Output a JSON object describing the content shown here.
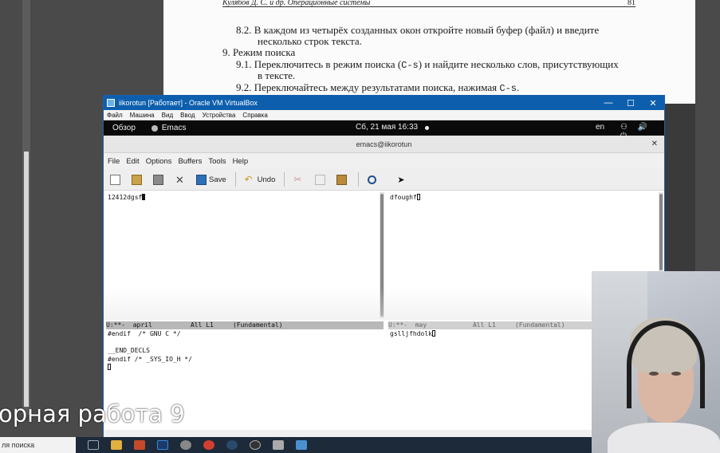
{
  "pdf": {
    "header_authors": "Кулябов Д. С. и др.",
    "header_title": "Операционные системы",
    "page_number": "81",
    "line1": "8.2.  В каждом из четырёх созданных окон откройте новый буфер (файл) и введите",
    "line2": "несколько строк текста.",
    "line3": "9.  Режим поиска",
    "line4a": "9.1.  Переключитесь в режим поиска (",
    "line4code": "C-s",
    "line4b": ") и найдите несколько слов, присутствующих",
    "line5": "в тексте.",
    "line6a": "9.2.  Переключайтесь между результатами поиска, нажимая ",
    "line6code": "C-s",
    "line6b": "."
  },
  "vbox": {
    "title": "iikorotun [Работает] - Oracle VM VirtualBox",
    "menu": [
      "Файл",
      "Машина",
      "Вид",
      "Ввод",
      "Устройства",
      "Справка"
    ],
    "controls": [
      "—",
      "☐",
      "✕"
    ]
  },
  "gnome": {
    "activities": "Обзор",
    "app": "Emacs",
    "clock": "Сб, 21 мая 16:33",
    "lang": "en",
    "sys_icons": "⚇ 🔊 ⏻"
  },
  "emacs": {
    "title": "emacs@iikorotun",
    "close": "✕",
    "menu": [
      "File",
      "Edit",
      "Options",
      "Buffers",
      "Tools",
      "Help"
    ],
    "toolbar": {
      "save": "Save",
      "undo": "Undo"
    },
    "windows": {
      "top_left_text": "12412dgsf",
      "top_right_text": "dfoughf",
      "bottom_left_lines": [
        "#endif  /* GNU C */",
        "",
        "__END_DECLS",
        "#endif /* _SYS_IO_H */"
      ],
      "bottom_right_text": "gslljfhdolk"
    },
    "modelines": {
      "left": "U:**-  april          All L1     (Fundamental)",
      "right": "U:**-  may            All L1     (Fundamental)"
    }
  },
  "host": {
    "slide_title": "орная работа 9",
    "search_text": "ля поиска"
  },
  "colors": {
    "vbox_titlebar": "#0d5fae",
    "gnome_bar": "#0a0a0a",
    "taskbar": "#1c2a3a"
  }
}
